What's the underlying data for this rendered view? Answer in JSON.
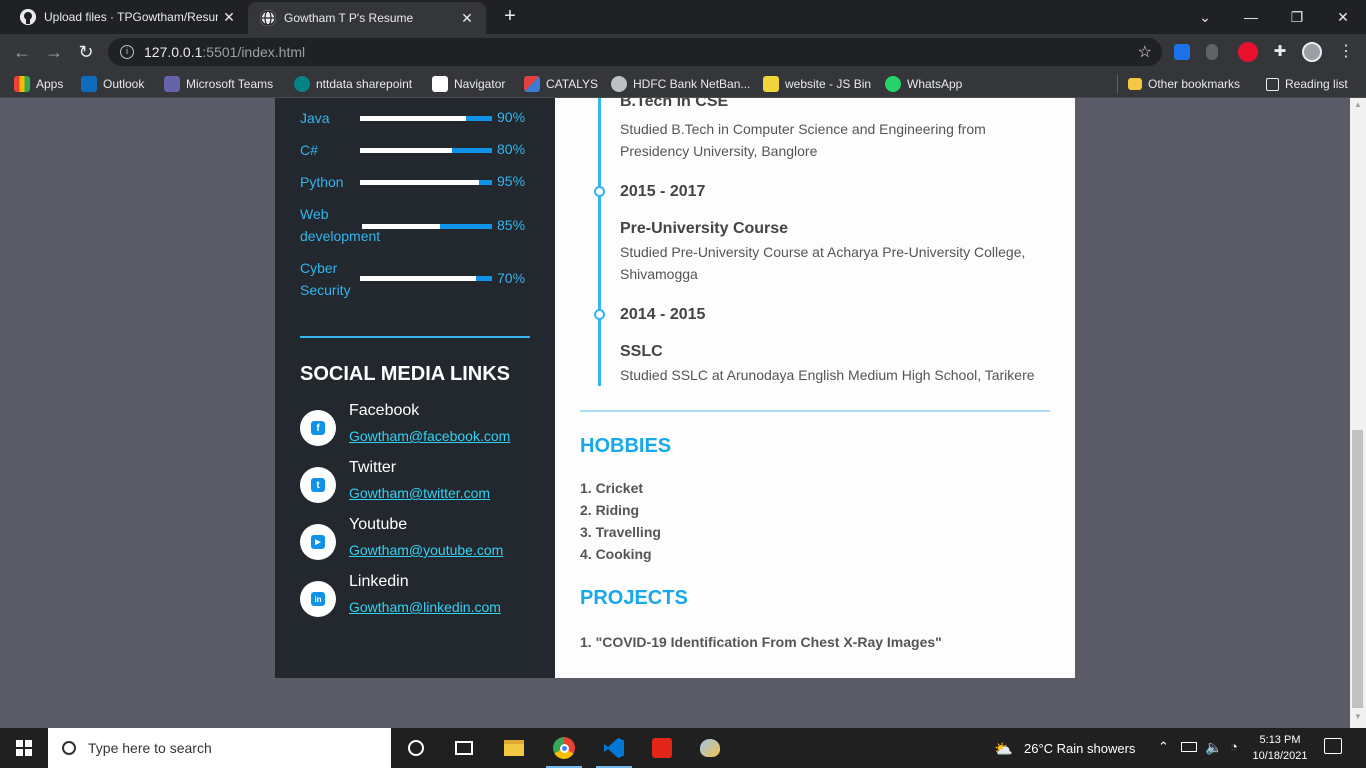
{
  "browser": {
    "tabs": [
      {
        "title": "Upload files · TPGowtham/Resum",
        "close": "✕"
      },
      {
        "title": "Gowtham T P's Resume",
        "close": "✕"
      }
    ],
    "new_tab": "+",
    "window_controls": {
      "minimize": "—",
      "maximize": "❐",
      "close": "✕",
      "tab_search": "⌄"
    },
    "url_host": "127.0.0.1",
    "url_rest": ":5501/index.html",
    "bookmarks": [
      {
        "label": "Apps",
        "icon": "apps-grid-icon",
        "color": "#ea4335"
      },
      {
        "label": "Outlook",
        "icon": "outlook-icon",
        "color": "#0f6cbd"
      },
      {
        "label": "Microsoft Teams",
        "icon": "teams-icon",
        "color": "#6264a7"
      },
      {
        "label": "nttdata sharepoint",
        "icon": "sharepoint-icon",
        "color": "#038387"
      },
      {
        "label": "Navigator",
        "icon": "navigator-icon",
        "color": "#ffffff"
      },
      {
        "label": "CATALYS",
        "icon": "catalys-icon",
        "color": "#e0413f"
      },
      {
        "label": "HDFC Bank NetBan...",
        "icon": "globe-icon",
        "color": "#bdc1c6"
      },
      {
        "label": "website - JS Bin",
        "icon": "jsbin-icon",
        "color": "#f0d43c"
      },
      {
        "label": "WhatsApp",
        "icon": "whatsapp-icon",
        "color": "#25d366"
      }
    ],
    "other_bookmarks": "Other bookmarks",
    "reading_list": "Reading list"
  },
  "skills": [
    {
      "name": "Java",
      "percent_label": "90%",
      "level": 0.8
    },
    {
      "name": "C#",
      "percent_label": "80%",
      "level": 0.7
    },
    {
      "name": "Python",
      "percent_label": "95%",
      "level": 0.9
    },
    {
      "name": "Web development",
      "percent_label": "85%",
      "level": 0.6
    },
    {
      "name": "Cyber Security",
      "percent_label": "70%",
      "level": 0.88
    }
  ],
  "social": {
    "title": "SOCIAL MEDIA LINKS",
    "links": [
      {
        "name": "Facebook",
        "link": "Gowtham@facebook.com",
        "icon": "facebook-icon",
        "glyph": "f"
      },
      {
        "name": "Twitter",
        "link": "Gowtham@twitter.com",
        "icon": "twitter-icon",
        "glyph": "t"
      },
      {
        "name": "Youtube",
        "link": "Gowtham@youtube.com",
        "icon": "youtube-icon",
        "glyph": "▶"
      },
      {
        "name": "Linkedin",
        "link": "Gowtham@linkedin.com",
        "icon": "linkedin-icon",
        "glyph": "in"
      }
    ]
  },
  "education": [
    {
      "heading": "B.Tech in CSE",
      "desc": "Studied B.Tech in Computer Science and Engineering from Presidency University, Banglore"
    },
    {
      "year": "2015 - 2017",
      "heading": "Pre-University Course",
      "desc": "Studied Pre-University Course at Acharya Pre-University College, Shivamogga"
    },
    {
      "year": "2014 - 2015",
      "heading": "SSLC",
      "desc": "Studied SSLC at Arunodaya English Medium High School, Tarikere"
    }
  ],
  "hobbies": {
    "title": "HOBBIES",
    "items": [
      "1. Cricket",
      "2. Riding",
      "3. Travelling",
      "4. Cooking"
    ]
  },
  "projects": {
    "title": "PROJECTS",
    "items": [
      "1. \"COVID-19 Identification From Chest X-Ray Images\""
    ]
  },
  "taskbar": {
    "search_placeholder": "Type here to search",
    "weather": "26°C  Rain showers",
    "time": "5:13 PM",
    "date": "10/18/2021"
  },
  "colors": {
    "accent": "#33b5f0",
    "sidebar_bg": "#22282d",
    "page_bg": "#5a5b66"
  }
}
